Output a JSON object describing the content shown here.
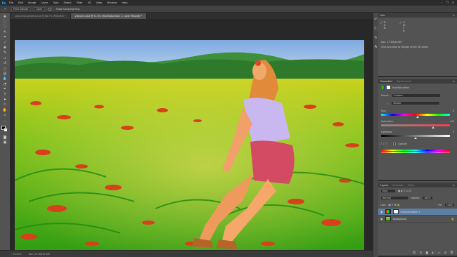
{
  "app": {
    "logo": "Ps"
  },
  "menu": [
    "File",
    "Edit",
    "Image",
    "Layer",
    "Type",
    "Select",
    "Filter",
    "3D",
    "View",
    "Window",
    "Help"
  ],
  "window_controls": [
    "–",
    "❐",
    "✕"
  ],
  "options_bar": {
    "sample_size": "Point Sample",
    "sample_mode": "Layer",
    "show_ring_label": "Show Sampling Ring"
  },
  "tabs": [
    {
      "label": "saturation-graphic.psd @ 66.7% (RGB/8#) *"
    },
    {
      "label": "vibrance.psd @ 31.3% (Hue/Saturation 1, Layer Mask/8) *"
    }
  ],
  "status": {
    "zoom": "31.27%",
    "doc": "Doc: 17.3M/34.6M"
  },
  "info_panel": {
    "tab": "Info",
    "readout_1": "R:\nG:\nB:",
    "readout_2": "C:\nM:\nY:\nK:",
    "doc_label": "Doc: 17.3M/34.6M",
    "hint": "Click and drag to change all the 3D views."
  },
  "properties_panel": {
    "tabs": [
      "Properties",
      "Adjustments"
    ],
    "adjustment_name": "Hue/Saturation",
    "preset_label": "Preset:",
    "preset_value": "Custom",
    "channel_value": "Master",
    "hue_label": "Hue:",
    "hue_value": "0",
    "saturation_label": "Saturation:",
    "saturation_value": "+50",
    "lightness_label": "Lightness:",
    "lightness_value": "0",
    "colorize_label": "Colorize",
    "hue_level": 0.53,
    "saturation_level": 0.75,
    "lightness_level": 0.5
  },
  "layers_panel": {
    "tabs": [
      "Layers",
      "Channels",
      "Paths"
    ],
    "kind_label": "Kind",
    "blend_mode": "Normal",
    "opacity_label": "Opacity:",
    "opacity_value": "100%",
    "lock_label": "Lock:",
    "fill_label": "Fill:",
    "fill_value": "100%",
    "layers": [
      {
        "name": "Hue/Saturation 1"
      },
      {
        "name": "Background"
      }
    ]
  },
  "tools": [
    "move-icon",
    "marquee-icon",
    "lasso-icon",
    "quick-select-icon",
    "crop-icon",
    "eyedropper-icon",
    "healing-icon",
    "brush-icon",
    "clone-stamp-icon",
    "history-brush-icon",
    "eraser-icon",
    "gradient-icon",
    "blur-icon",
    "dodge-icon",
    "pen-icon",
    "type-icon",
    "path-select-icon",
    "rectangle-icon",
    "hand-icon",
    "zoom-icon"
  ]
}
